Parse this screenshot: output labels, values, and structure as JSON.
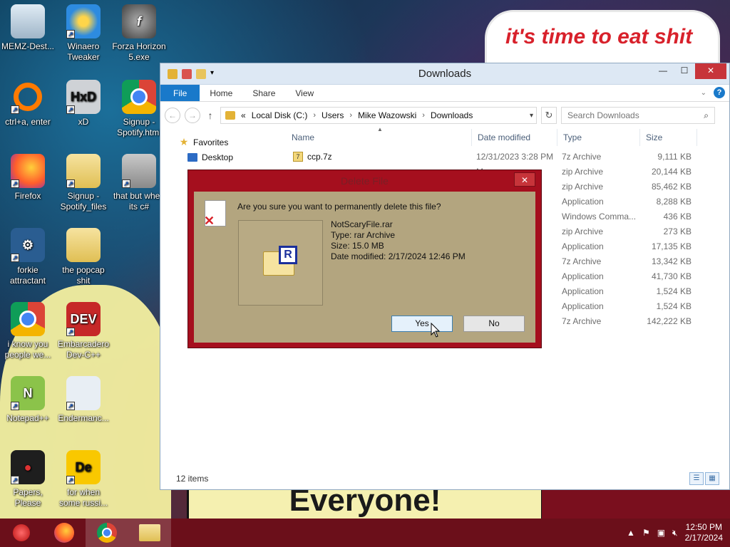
{
  "wallpaper": {
    "banner_text": "it's time to eat shit",
    "bottom_text": "Everyone!"
  },
  "desktop_icons": [
    {
      "label": "MEMZ-Dest...",
      "icon": "recycle-bin-icon"
    },
    {
      "label": "Winaero Tweaker",
      "icon": "winaero-icon"
    },
    {
      "label": "Forza Horizon 5.exe",
      "icon": "forza-icon"
    },
    {
      "label": "ctrl+a, enter",
      "icon": "ring-icon"
    },
    {
      "label": "xD",
      "icon": "hxd-icon"
    },
    {
      "label": "Signup - Spotify.html",
      "icon": "chrome-icon"
    },
    {
      "label": "Firefox",
      "icon": "firefox-icon"
    },
    {
      "label": "Signup - Spotify_files",
      "icon": "folder-icon"
    },
    {
      "label": "that but when its c#",
      "icon": "stack-icon"
    },
    {
      "label": "forkie attractant",
      "icon": "forkie-icon"
    },
    {
      "label": "the popcap shit",
      "icon": "folder-icon"
    },
    {
      "label": "i know you people we...",
      "icon": "chrome-icon"
    },
    {
      "label": "Embarcadero Dev-C++",
      "icon": "devcpp-icon"
    },
    {
      "label": "Notepad++",
      "icon": "notepadpp-icon"
    },
    {
      "label": "Endermanc...",
      "icon": "endermanch-icon"
    },
    {
      "label": "Papers, Please",
      "icon": "papers-please-icon"
    },
    {
      "label": "for when some russi...",
      "icon": "de-icon"
    }
  ],
  "explorer": {
    "title": "Downloads",
    "ribbon_tabs": [
      "File",
      "Home",
      "Share",
      "View"
    ],
    "address": {
      "prefix": "«",
      "crumbs": [
        "Local Disk (C:)",
        "Users",
        "Mike Wazowski",
        "Downloads"
      ]
    },
    "search_placeholder": "Search Downloads",
    "nav": {
      "favorites": "Favorites",
      "desktop": "Desktop"
    },
    "columns": [
      "Name",
      "Date modified",
      "Type",
      "Size"
    ],
    "rows": [
      {
        "name": "ccp.7z",
        "date": "12/31/2023 3:28 PM",
        "type": "7z Archive",
        "size": "9,111 KB"
      },
      {
        "name": "",
        "date": "M",
        "type": "zip Archive",
        "size": "20,144 KB"
      },
      {
        "name": "",
        "date": "M",
        "type": "zip Archive",
        "size": "85,462 KB"
      },
      {
        "name": "",
        "date": "M",
        "type": "Application",
        "size": "8,288 KB"
      },
      {
        "name": "",
        "date": "AM",
        "type": "Windows Comma...",
        "size": "436 KB"
      },
      {
        "name": "",
        "date": "M",
        "type": "zip Archive",
        "size": "273 KB"
      },
      {
        "name": "",
        "date": "M",
        "type": "Application",
        "size": "17,135 KB"
      },
      {
        "name": "",
        "date": "M",
        "type": "7z Archive",
        "size": "13,342 KB"
      },
      {
        "name": "",
        "date": "M",
        "type": "Application",
        "size": "41,730 KB"
      },
      {
        "name": "",
        "date": "M",
        "type": "Application",
        "size": "1,524 KB"
      },
      {
        "name": "",
        "date": "M",
        "type": "Application",
        "size": "1,524 KB"
      },
      {
        "name": "",
        "date": "M",
        "type": "7z Archive",
        "size": "142,222 KB"
      }
    ],
    "status": "12 items"
  },
  "dialog": {
    "title": "Delete File",
    "question": "Are you sure you want to permanently delete this file?",
    "file_name": "NotScaryFile.rar",
    "file_type": "Type: rar Archive",
    "file_size": "Size: 15.0 MB",
    "file_date": "Date modified: 2/17/2024 12:46 PM",
    "yes_label": "Yes",
    "no_label": "No"
  },
  "taskbar": {
    "time": "12:50 PM",
    "date": "2/17/2024"
  },
  "colors": {
    "dialog_frame": "#a50f1e",
    "dialog_body": "#b3a57f",
    "taskbar": "#6b0f1a",
    "ribbon_file": "#1979ca"
  }
}
